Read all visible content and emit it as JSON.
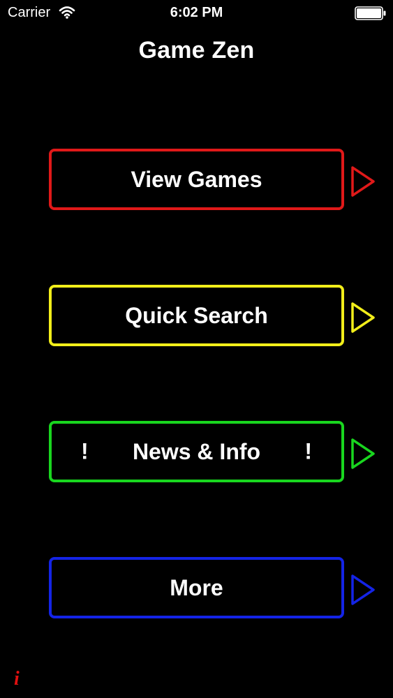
{
  "status_bar": {
    "carrier": "Carrier",
    "time": "6:02 PM",
    "wifi_icon": "wifi-icon",
    "battery_icon": "battery-icon"
  },
  "header": {
    "title": "Game Zen"
  },
  "menu": {
    "items": [
      {
        "label": "View Games",
        "color": "#e01919",
        "arrow_icon": "play-triangle-icon"
      },
      {
        "label": "Quick Search",
        "color": "#f2ee1a",
        "arrow_icon": "play-triangle-icon"
      },
      {
        "label": "News & Info",
        "badge_left": "!",
        "badge_right": "!",
        "color": "#19d61f",
        "arrow_icon": "play-triangle-icon"
      },
      {
        "label": "More",
        "color": "#1424e6",
        "arrow_icon": "play-triangle-icon"
      }
    ]
  },
  "footer": {
    "info_label": "i",
    "info_color": "#e01010"
  }
}
